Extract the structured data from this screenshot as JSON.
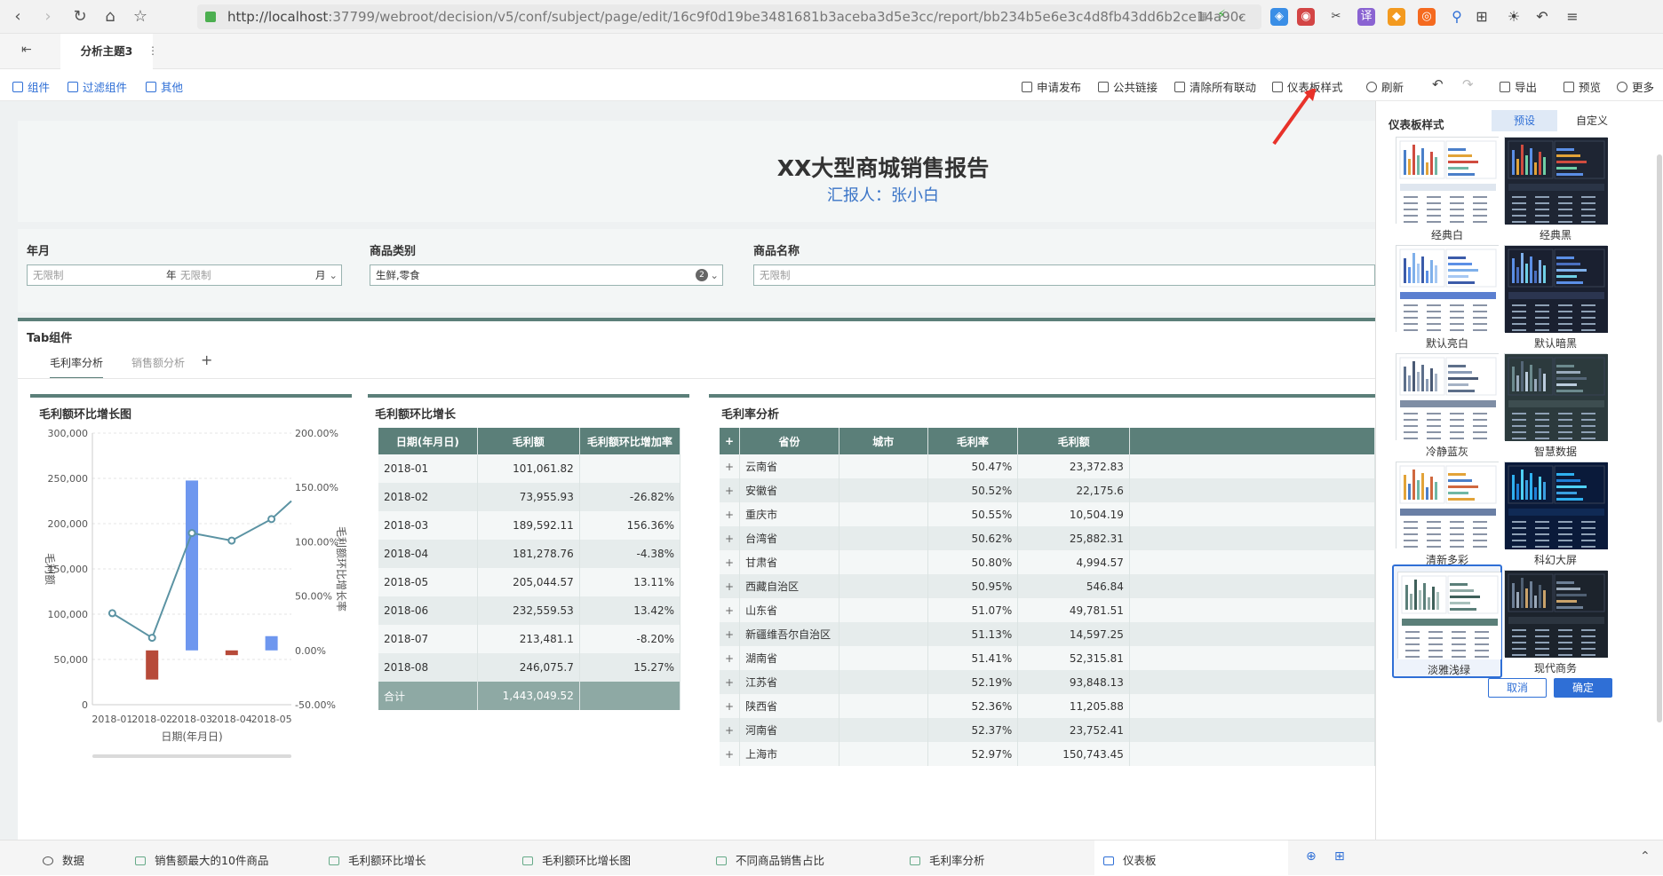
{
  "browser": {
    "url_host": "http://localhost",
    "url_rest": ":37799/webroot/decision/v5/conf/subject/page/edit/16c9f0d19be3481681b3aceba3d5e3cc/report/bb234b5e6e3c4d8fb43dd6b2ce14a90c"
  },
  "app": {
    "tab_title": "分析主题3",
    "more": "⋮"
  },
  "toolbar": {
    "left": [
      "组件",
      "过滤组件",
      "其他"
    ],
    "right": [
      "申请发布",
      "公共链接",
      "清除所有联动",
      "仪表板样式",
      "刷新",
      "导出",
      "预览",
      "更多"
    ]
  },
  "dashboard": {
    "title": "XX大型商城销售报告",
    "subtitle": "汇报人：张小白",
    "filters": [
      {
        "label": "年月",
        "value1": "无限制",
        "unit1": "年",
        "value2": "无限制",
        "unit2": "月"
      },
      {
        "label": "商品类别",
        "value": "生鲜,零食",
        "count": "2"
      },
      {
        "label": "商品名称",
        "value": "无限制"
      }
    ],
    "tab_widget_title": "Tab组件",
    "tabs": [
      "毛利率分析",
      "销售额分析"
    ],
    "add_tab": "+"
  },
  "chart1": {
    "title": "毛利额环比增长图",
    "y_left_ticks": [
      "300,000",
      "250,000",
      "200,000",
      "150,000",
      "100,000",
      "50,000",
      "0"
    ],
    "y_right_ticks": [
      "200.00%",
      "150.00%",
      "100.00%",
      "50.00%",
      "0.00%",
      "-50.00%"
    ],
    "x_ticks": [
      "2018-01",
      "2018-02",
      "2018-03",
      "2018-04",
      "2018-05"
    ],
    "ylabel_left": "毛利额",
    "ylabel_right": "毛利额环比增长率",
    "xlabel": "日期(年月日)"
  },
  "chart_data": {
    "type": "bar",
    "categories": [
      "2018-01",
      "2018-02",
      "2018-03",
      "2018-04",
      "2018-05"
    ],
    "series": [
      {
        "name": "毛利额",
        "type": "bar",
        "axis": "right",
        "values": [
          null,
          -26.82,
          156.36,
          -4.38,
          13.11
        ]
      },
      {
        "name": "毛利额环比增长率",
        "type": "line",
        "axis": "left",
        "values": [
          101061.82,
          73955.93,
          189592.11,
          181278.76,
          205044.57
        ]
      }
    ],
    "xlabel": "日期(年月日)",
    "ylabel": "毛利额",
    "ylabel_right": "毛利额环比增长率",
    "ylim": [
      0,
      300000
    ],
    "ylim_right": [
      -50,
      200
    ],
    "colors": {
      "positive": "#6e97ef",
      "negative": "#b74a39",
      "line": "#5b93a3"
    }
  },
  "table1": {
    "title": "毛利额环比增长",
    "headers": [
      "日期(年月日)",
      "毛利额",
      "毛利额环比增加率"
    ],
    "rows": [
      [
        "2018-01",
        "101,061.82",
        ""
      ],
      [
        "2018-02",
        "73,955.93",
        "-26.82%"
      ],
      [
        "2018-03",
        "189,592.11",
        "156.36%"
      ],
      [
        "2018-04",
        "181,278.76",
        "-4.38%"
      ],
      [
        "2018-05",
        "205,044.57",
        "13.11%"
      ],
      [
        "2018-06",
        "232,559.53",
        "13.42%"
      ],
      [
        "2018-07",
        "213,481.1",
        "-8.20%"
      ],
      [
        "2018-08",
        "246,075.7",
        "15.27%"
      ]
    ],
    "total_label": "合计",
    "total_value": "1,443,049.52"
  },
  "table2": {
    "title": "毛利率分析",
    "headers": [
      "+",
      "省份",
      "城市",
      "毛利率",
      "毛利额"
    ],
    "rows": [
      [
        "云南省",
        "50.47%",
        "23,372.83"
      ],
      [
        "安徽省",
        "50.52%",
        "22,175.6"
      ],
      [
        "重庆市",
        "50.55%",
        "10,504.19"
      ],
      [
        "台湾省",
        "50.62%",
        "25,882.31"
      ],
      [
        "甘肃省",
        "50.80%",
        "4,994.57"
      ],
      [
        "西藏自治区",
        "50.95%",
        "546.84"
      ],
      [
        "山东省",
        "51.07%",
        "49,781.51"
      ],
      [
        "新疆维吾尔自治区",
        "51.13%",
        "14,597.25"
      ],
      [
        "湖南省",
        "51.41%",
        "52,315.81"
      ],
      [
        "江苏省",
        "52.19%",
        "93,848.13"
      ],
      [
        "陕西省",
        "52.36%",
        "11,205.88"
      ],
      [
        "河南省",
        "52.37%",
        "23,752.41"
      ],
      [
        "上海市",
        "52.97%",
        "150,743.45"
      ]
    ]
  },
  "side": {
    "title": "仪表板样式",
    "tab_preset": "预设",
    "tab_custom": "自定义",
    "themes": [
      "经典白",
      "经典黑",
      "默认亮白",
      "默认暗黑",
      "冷静蓝灰",
      "智慧数据",
      "清新多彩",
      "科幻大屏",
      "淡雅浅绿",
      "现代商务"
    ],
    "cancel": "取消",
    "ok": "确定"
  },
  "bottom": {
    "tabs": [
      "数据",
      "销售额最大的10件商品",
      "毛利额环比增长",
      "毛利额环比增长图",
      "不同商品销售占比",
      "毛利率分析",
      "仪表板"
    ]
  }
}
